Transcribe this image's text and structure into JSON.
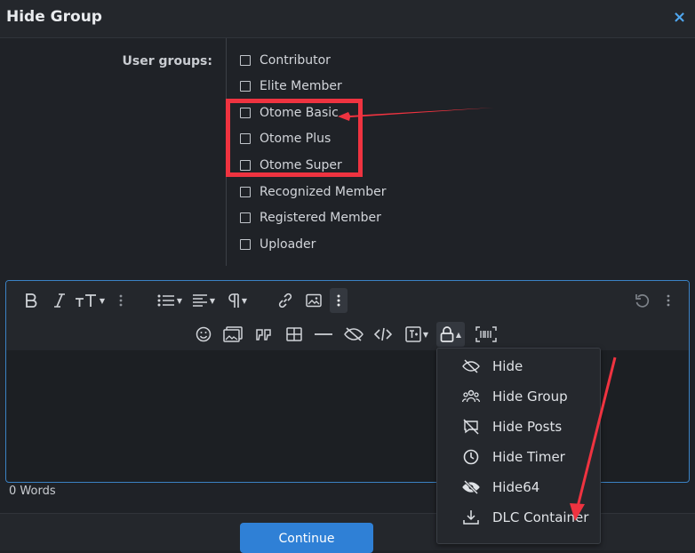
{
  "dialog": {
    "title": "Hide Group",
    "close_glyph": "×"
  },
  "form": {
    "user_groups_label": "User groups:",
    "groups": [
      {
        "label": "Contributor",
        "checked": false
      },
      {
        "label": "Elite Member",
        "checked": false
      },
      {
        "label": "Otome Basic",
        "checked": false
      },
      {
        "label": "Otome Plus",
        "checked": false
      },
      {
        "label": "Otome Super",
        "checked": false
      },
      {
        "label": "Recognized Member",
        "checked": false
      },
      {
        "label": "Registered Member",
        "checked": false
      },
      {
        "label": "Uploader",
        "checked": false
      }
    ]
  },
  "editor": {
    "toolbar_row1": [
      "bold-icon",
      "italic-icon",
      "text-size-icon",
      "more-vertical-icon",
      "list-icon",
      "align-icon",
      "paragraph-icon",
      "link-icon",
      "image-icon",
      "more-vertical-icon",
      "undo-icon",
      "more-vertical-icon"
    ],
    "toolbar_row2": [
      "smiley-icon",
      "media-icon",
      "quote-icon",
      "table-icon",
      "horizontal-rule-icon",
      "spoiler-icon",
      "code-icon",
      "insert-icon",
      "lock-icon",
      "barcode-icon"
    ],
    "word_count": "0 Words"
  },
  "dropdown": {
    "items": [
      {
        "label": "Hide",
        "icon": "eye-slash-icon"
      },
      {
        "label": "Hide Group",
        "icon": "users-icon"
      },
      {
        "label": "Hide Posts",
        "icon": "comment-slash-icon"
      },
      {
        "label": "Hide Timer",
        "icon": "clock-icon"
      },
      {
        "label": "Hide64",
        "icon": "eye-slash-icon"
      },
      {
        "label": "DLC Container",
        "icon": "download-icon"
      }
    ]
  },
  "footer": {
    "continue_label": "Continue"
  },
  "colors": {
    "accent": "#2f80d6",
    "annotation_red": "#ef3340",
    "background": "#1f2227"
  }
}
